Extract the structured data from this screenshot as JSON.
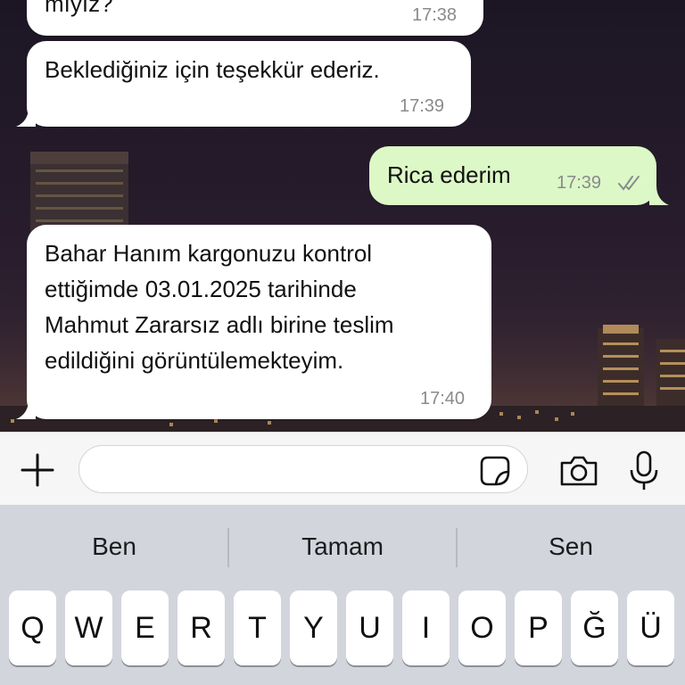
{
  "messages": [
    {
      "direction": "incoming",
      "lines": [
        "mıyız?"
      ],
      "time": "17:38"
    },
    {
      "direction": "incoming",
      "lines": [
        "Beklediğiniz için teşekkür ederiz."
      ],
      "time": "17:39"
    },
    {
      "direction": "outgoing",
      "lines": [
        "Rica ederim"
      ],
      "time": "17:39",
      "status": "read-double-check-icon"
    },
    {
      "direction": "incoming",
      "lines": [
        "Bahar Hanım kargonuzu kontrol",
        "ettiğimde 03.01.2025 tarihinde",
        "Mahmut Zararsız adlı birine teslim",
        "edildiğini görüntülemekteyim."
      ],
      "time": "17:40"
    }
  ],
  "input_bar": {
    "attach_icon": "plus-icon",
    "text_value": "",
    "sticker_icon": "sticker-icon",
    "camera_icon": "camera-icon",
    "mic_icon": "microphone-icon"
  },
  "keyboard": {
    "suggestions": [
      "Ben",
      "Tamam",
      "Sen"
    ],
    "row1": [
      "Q",
      "W",
      "E",
      "R",
      "T",
      "Y",
      "U",
      "I",
      "O",
      "P",
      "Ğ",
      "Ü"
    ]
  },
  "colors": {
    "incoming_bubble": "#ffffff",
    "outgoing_bubble": "#dcf8c6",
    "read_check": "#8a8a8e",
    "keyboard_bg": "#d2d5db"
  }
}
